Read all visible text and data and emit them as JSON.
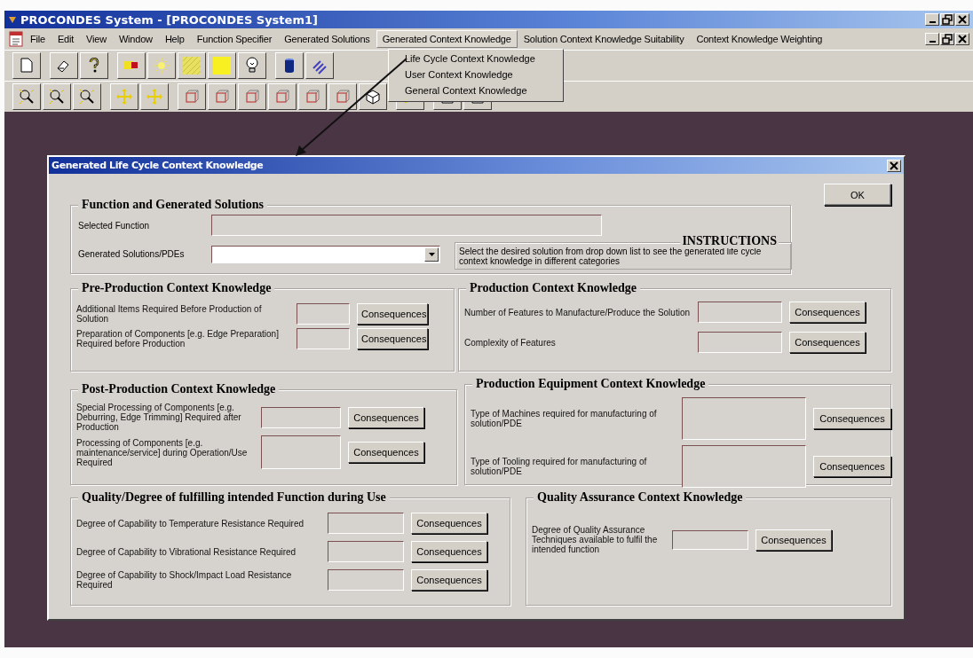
{
  "window": {
    "title": "PROCONDES System - [PROCONDES System1]"
  },
  "menu_bar": {
    "items": [
      {
        "label": "File",
        "selected": false
      },
      {
        "label": "Edit",
        "selected": false
      },
      {
        "label": "View",
        "selected": false
      },
      {
        "label": "Window",
        "selected": false
      },
      {
        "label": "Help",
        "selected": false
      },
      {
        "label": "Function Specifier",
        "selected": false
      },
      {
        "label": "Generated Solutions",
        "selected": false
      },
      {
        "label": "Generated Context Knowledge",
        "selected": true
      },
      {
        "label": "Solution Context Knowledge Suitability",
        "selected": false
      },
      {
        "label": "Context Knowledge Weighting",
        "selected": false
      }
    ]
  },
  "menu_dropdown": {
    "items": [
      "Life Cycle Context Knowledge",
      "User Context Knowledge",
      "General Context Knowledge"
    ]
  },
  "dialog": {
    "title": "Generated Life Cycle Context Knowledge",
    "ok_button": "OK",
    "function_group": {
      "title": "Function and Generated Solutions",
      "selected_function_label": "Selected Function",
      "solutions_label": "Generated Solutions/PDEs",
      "instructions": {
        "title": "INSTRUCTIONS",
        "text": "Select the desired solution from drop down list to see the generated life cycle context knowledge in different categories"
      }
    },
    "groups": [
      {
        "title": "Pre-Production Context Knowledge",
        "rows": [
          {
            "label": "Additional Items  Required Before Production of Solution",
            "button": "Consequences"
          },
          {
            "label": "Preparation of Components [e.g. Edge Preparation] Required before Production",
            "button": "Consequences"
          }
        ]
      },
      {
        "title": "Production Context Knowledge",
        "rows": [
          {
            "label": "Number of Features to Manufacture/Produce the Solution",
            "button": "Consequences"
          },
          {
            "label": "Complexity of Features",
            "button": "Consequences"
          }
        ]
      },
      {
        "title": "Post-Production Context Knowledge",
        "rows": [
          {
            "label": "Special Processing of Components [e.g. Deburring, Edge Trimming] Required after Production",
            "button": "Consequences"
          },
          {
            "label": "Processing of Components [e.g. maintenance/service] during Operation/Use Required",
            "button": "Consequences"
          }
        ]
      },
      {
        "title": "Production Equipment Context Knowledge",
        "rows": [
          {
            "label": "Type of Machines required for manufacturing of solution/PDE",
            "button": "Consequences"
          },
          {
            "label": "Type of Tooling required for manufacturing of solution/PDE",
            "button": "Consequences"
          }
        ]
      },
      {
        "title": "Quality/Degree of fulfilling intended Function during Use",
        "rows": [
          {
            "label": "Degree of Capability to Temperature Resistance Required",
            "button": "Consequences"
          },
          {
            "label": "Degree of Capability to Vibrational Resistance Required",
            "button": "Consequences"
          },
          {
            "label": "Degree of Capability to Shock/Impact Load Resistance Required",
            "button": "Consequences"
          }
        ]
      },
      {
        "title": "Quality Assurance Context Knowledge",
        "rows": [
          {
            "label": "Degree of Quality Assurance Techniques available to fulfil the intended function",
            "button": "Consequences"
          }
        ]
      }
    ]
  }
}
